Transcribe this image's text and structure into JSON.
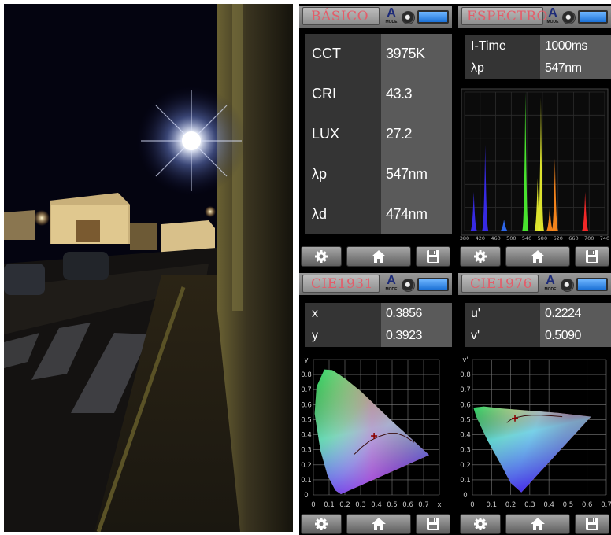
{
  "panels": {
    "basic": {
      "title": "BÁSICO",
      "mode_letter": "A",
      "mode_label": "MODE",
      "rows": [
        {
          "label": "CCT",
          "value": "3975K"
        },
        {
          "label": "CRI",
          "value": "43.3"
        },
        {
          "label": "LUX",
          "value": "27.2"
        },
        {
          "label": "λp",
          "value": "547nm"
        },
        {
          "label": "λd",
          "value": "474nm"
        }
      ]
    },
    "spectrum": {
      "title": "ESPECTRO",
      "mode_letter": "A",
      "mode_label": "MODE",
      "rows": [
        {
          "label": "I-Time",
          "value": "1000ms"
        },
        {
          "label": "λp",
          "value": "547nm"
        }
      ]
    },
    "cie1931": {
      "title": "CIE1931",
      "mode_letter": "A",
      "mode_label": "MODE",
      "rows": [
        {
          "label": "x",
          "value": "0.3856"
        },
        {
          "label": "y",
          "value": "0.3923"
        }
      ]
    },
    "cie1976": {
      "title": "CIE1976",
      "mode_letter": "A",
      "mode_label": "MODE",
      "rows": [
        {
          "label": "u'",
          "value": "0.2224"
        },
        {
          "label": "v'",
          "value": "0.5090"
        }
      ]
    }
  },
  "icons": {
    "settings": "gear-icon",
    "home": "home-icon",
    "save": "floppy-disk-icon",
    "mode": "mode-a-icon",
    "knob": "dial-knob-icon",
    "battery": "battery-icon"
  },
  "colors": {
    "title_text": "#e35d6a",
    "battery": "#1d72d6",
    "label_cell": "#343434",
    "value_cell": "#5a5a5a"
  },
  "chart_data": [
    {
      "type": "line",
      "x_tick_labels": [
        "380",
        "420",
        "460",
        "500",
        "540",
        "580",
        "620",
        "660",
        "700",
        "740"
      ],
      "xlim": [
        380,
        760
      ],
      "peaks_nm": [
        {
          "x": 405,
          "y": 0.28
        },
        {
          "x": 436,
          "y": 0.62
        },
        {
          "x": 487,
          "y": 0.08
        },
        {
          "x": 545,
          "y": 1.0
        },
        {
          "x": 578,
          "y": 0.38
        },
        {
          "x": 587,
          "y": 0.96
        },
        {
          "x": 611,
          "y": 0.18
        },
        {
          "x": 625,
          "y": 0.52
        },
        {
          "x": 707,
          "y": 0.28
        }
      ]
    },
    {
      "type": "scatter",
      "x_tick_labels": [
        "0",
        "0.1",
        "0.2",
        "0.3",
        "0.4",
        "0.5",
        "0.6",
        "0.7",
        "x"
      ],
      "y_tick_labels": [
        "0",
        "0.1",
        "0.2",
        "0.3",
        "0.4",
        "0.5",
        "0.6",
        "0.7",
        "0.8",
        "y"
      ],
      "xlim": [
        0,
        0.8
      ],
      "ylim": [
        0,
        0.9
      ],
      "point": {
        "x": 0.3856,
        "y": 0.3923
      }
    },
    {
      "type": "scatter",
      "x_tick_labels": [
        "0",
        "0.1",
        "0.2",
        "0.3",
        "0.4",
        "0.5",
        "0.6",
        "0.7"
      ],
      "y_tick_labels": [
        "0",
        "0.1",
        "0.2",
        "0.3",
        "0.4",
        "0.5",
        "0.6",
        "0.7",
        "0.8",
        "v'"
      ],
      "xlim": [
        0,
        0.7
      ],
      "ylim": [
        0,
        0.9
      ],
      "point": {
        "x": 0.2224,
        "y": 0.509
      }
    }
  ]
}
